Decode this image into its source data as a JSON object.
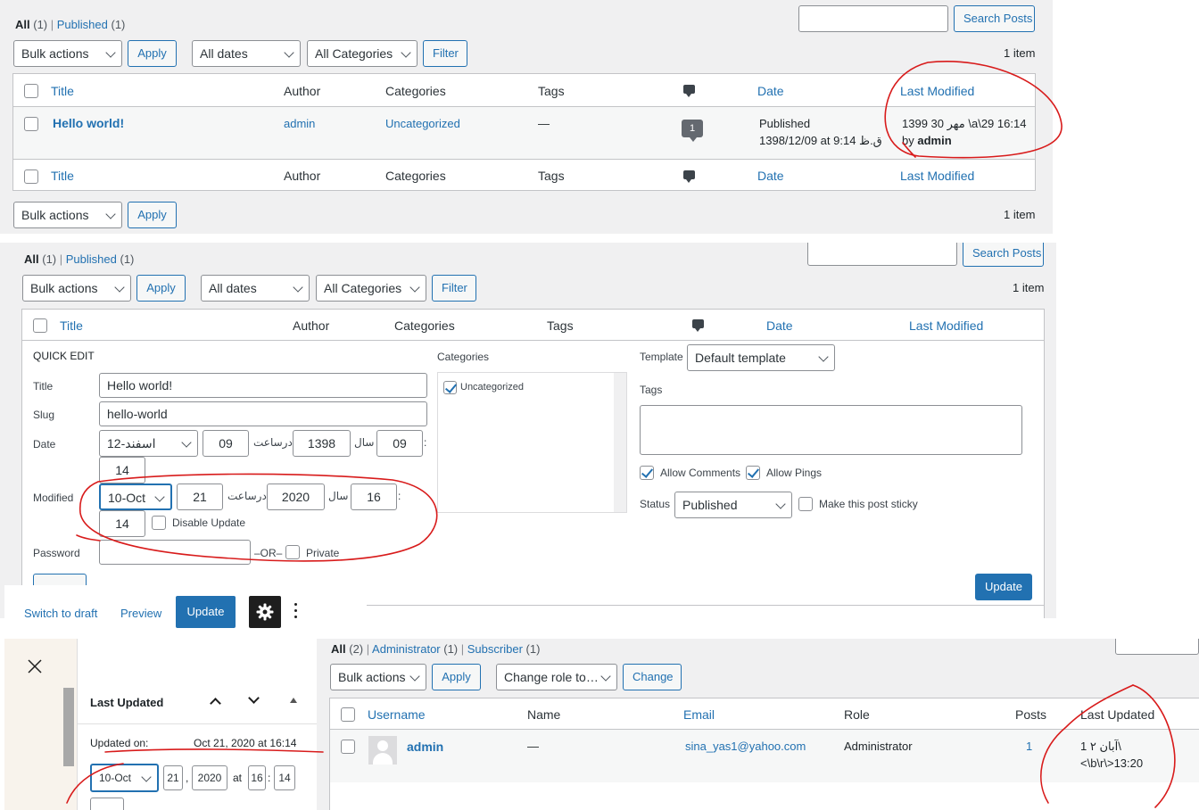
{
  "panel1": {
    "filters": {
      "all": "All",
      "all_count": "(1)",
      "published": "Published",
      "published_count": "(1)"
    },
    "search_button": "Search Posts",
    "bulk_actions": "Bulk actions",
    "apply": "Apply",
    "all_dates": "All dates",
    "all_categories": "All Categories",
    "filter": "Filter",
    "item_count": "1 item",
    "columns": {
      "title": "Title",
      "author": "Author",
      "categories": "Categories",
      "tags": "Tags",
      "date": "Date",
      "last_modified": "Last Modified"
    },
    "row": {
      "title": "Hello world!",
      "author": "admin",
      "category": "Uncategorized",
      "tags": "—",
      "comments": "1",
      "date_status": "Published",
      "date_value": "1398/12/09 at 9:14 ق.ظ",
      "modified_value": "1399 30 مهر \\a\\29 16:14",
      "modified_by": "by",
      "modified_user": "admin"
    }
  },
  "panel2": {
    "filters": {
      "all": "All",
      "all_count": "(1)",
      "published": "Published",
      "published_count": "(1)"
    },
    "search_button": "Search Posts",
    "bulk_actions": "Bulk actions",
    "apply": "Apply",
    "all_dates": "All dates",
    "all_categories": "All Categories",
    "filter": "Filter",
    "item_count": "1 item",
    "columns": {
      "title": "Title",
      "author": "Author",
      "categories": "Categories",
      "tags": "Tags",
      "date": "Date",
      "last_modified": "Last Modified"
    },
    "quick_edit": {
      "heading": "QUICK EDIT",
      "title_label": "Title",
      "title_value": "Hello world!",
      "slug_label": "Slug",
      "slug_value": "hello-world",
      "date_label": "Date",
      "date_month": "12-اسفند",
      "date_day": "09",
      "date_at": "درساعت",
      "date_year": "1398",
      "date_year_label": "سال",
      "date_hour": "09",
      "colon": ":",
      "date_min": "14",
      "modified_label": "Modified",
      "mod_month": "10-Oct",
      "mod_day": "21",
      "mod_at": "درساعت",
      "mod_year": "2020",
      "mod_year_label": "سال",
      "mod_hour": "16",
      "mod_min": "14",
      "disable_update": "Disable Update",
      "password_label": "Password",
      "or": "–OR–",
      "private": "Private",
      "categories_label": "Categories",
      "category_item": "Uncategorized",
      "template_label": "Template",
      "template_value": "Default template",
      "tags_label": "Tags",
      "allow_comments": "Allow Comments",
      "allow_pings": "Allow Pings",
      "status_label": "Status",
      "status_value": "Published",
      "sticky": "Make this post sticky",
      "update": "Update"
    }
  },
  "editor": {
    "switch_to_draft": "Switch to draft",
    "preview": "Preview",
    "update": "Update",
    "panel_title": "Last Updated",
    "updated_on_label": "Updated on:",
    "updated_on_value": "Oct 21, 2020 at 16:14",
    "month": "10-Oct",
    "day": "21",
    "comma": ",",
    "year": "2020",
    "at": "at",
    "hour": "16",
    "colon": ":",
    "min": "14"
  },
  "users": {
    "filters": {
      "all": "All",
      "all_count": "(2)",
      "administrator": "Administrator",
      "administrator_count": "(1)",
      "subscriber": "Subscriber",
      "subscriber_count": "(1)"
    },
    "bulk_actions": "Bulk actions",
    "apply": "Apply",
    "change_role": "Change role to…",
    "change": "Change",
    "columns": {
      "username": "Username",
      "name": "Name",
      "email": "Email",
      "role": "Role",
      "posts": "Posts",
      "last_updated": "Last Updated"
    },
    "row": {
      "username": "admin",
      "name": "—",
      "email": "sina_yas1@yahoo.com",
      "role": "Administrator",
      "posts": "1",
      "last_updated_line1": "1 آبان ۲\\",
      "last_updated_line2": "<\\b\\r\\>13:20"
    }
  },
  "colors": {
    "link": "#2271b1",
    "background": "#f0f0f1",
    "annotation": "#d81b1b",
    "dark": "#1e1e1e"
  }
}
